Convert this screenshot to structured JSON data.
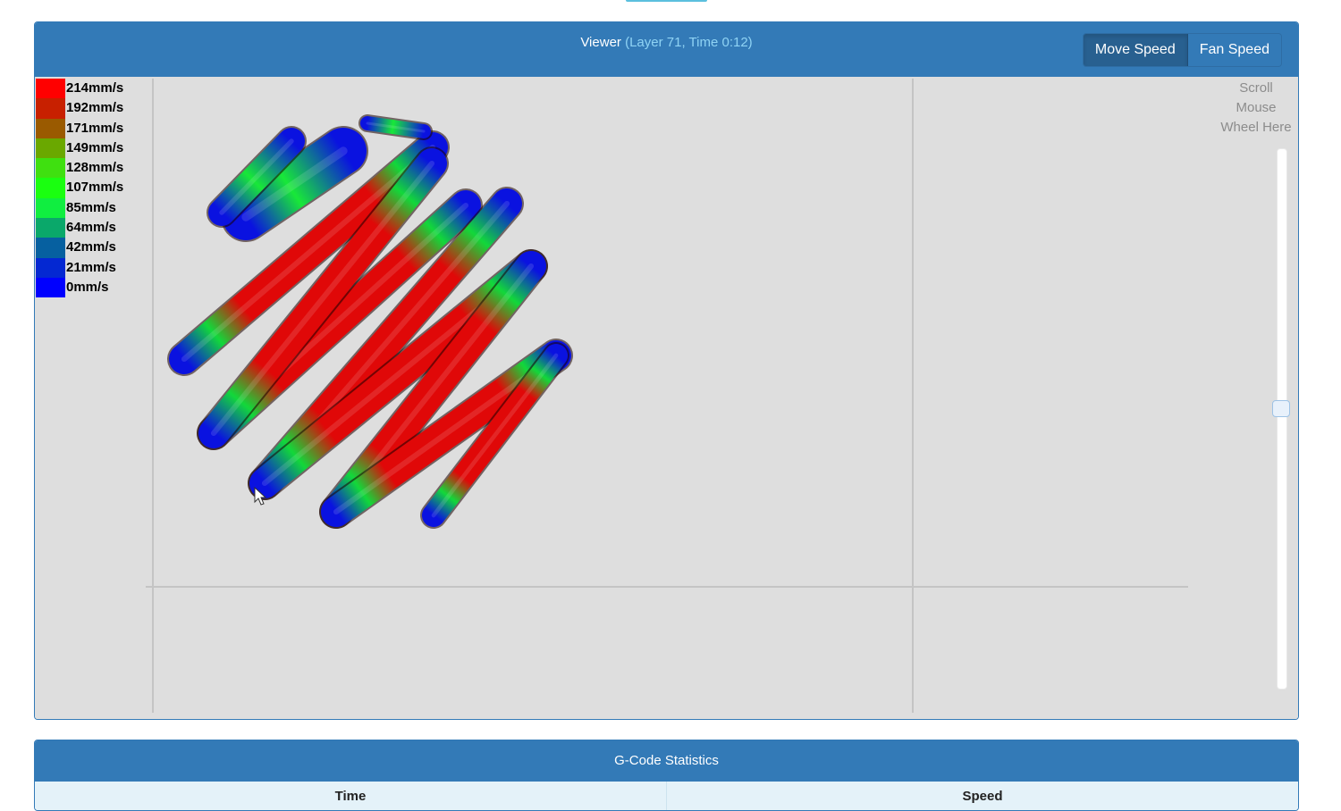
{
  "viewer": {
    "title": "Viewer",
    "subtitle": "(Layer 71, Time 0:12)",
    "buttons": [
      {
        "label": "Move Speed",
        "active": true
      },
      {
        "label": "Fan Speed",
        "active": false
      }
    ],
    "scroll_hint": [
      "Scroll",
      "Mouse",
      "Wheel Here"
    ],
    "legend": [
      {
        "label": "214mm/s",
        "color": "#ff0000"
      },
      {
        "label": "192mm/s",
        "color": "#c82000"
      },
      {
        "label": "171mm/s",
        "color": "#9a5a00"
      },
      {
        "label": "149mm/s",
        "color": "#6aa800"
      },
      {
        "label": "128mm/s",
        "color": "#3fe010"
      },
      {
        "label": "107mm/s",
        "color": "#1aff10"
      },
      {
        "label": "85mm/s",
        "color": "#10ee40"
      },
      {
        "label": "64mm/s",
        "color": "#0aa86a"
      },
      {
        "label": "42mm/s",
        "color": "#0660a0"
      },
      {
        "label": "21mm/s",
        "color": "#0428d2"
      },
      {
        "label": "0mm/s",
        "color": "#0000ff"
      }
    ],
    "layer_slider": {
      "position": 0.48
    }
  },
  "stats": {
    "title": "G-Code Statistics",
    "columns": [
      "Time",
      "Speed"
    ]
  }
}
